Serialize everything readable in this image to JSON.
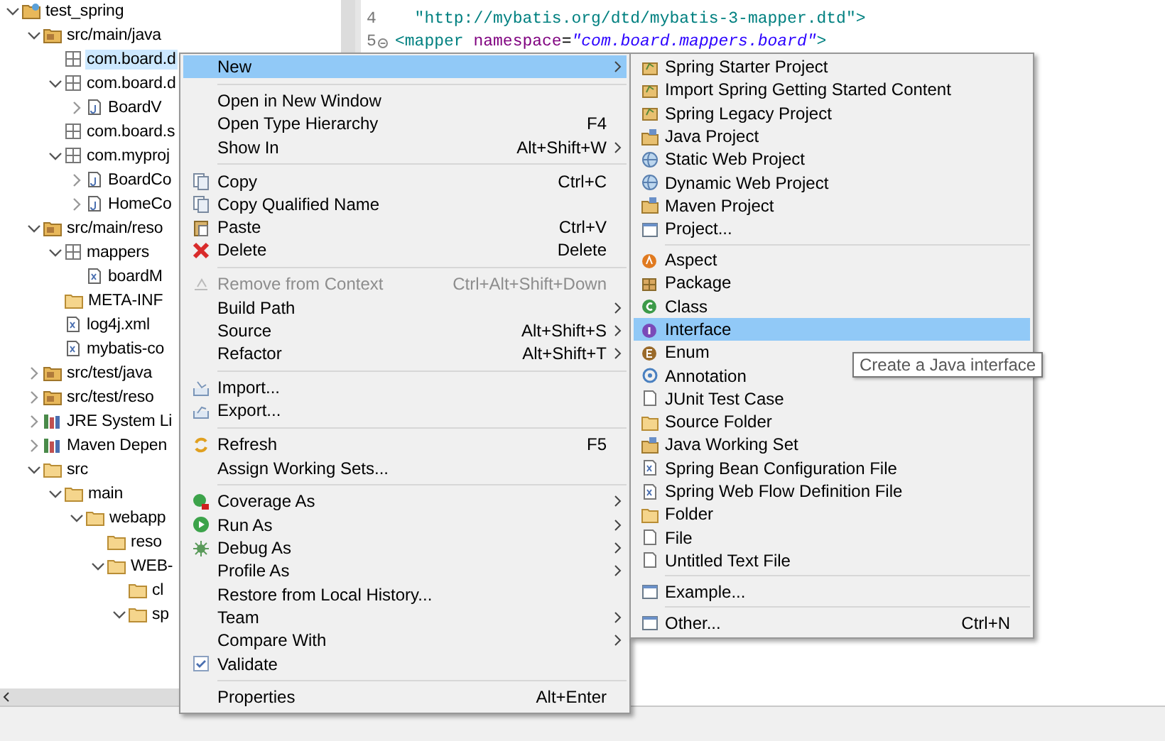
{
  "tree": [
    {
      "label": "test_spring",
      "kind": "project",
      "expanded": true,
      "selected": false,
      "children": [
        {
          "label": "src/main/java",
          "kind": "source-folder",
          "expanded": true,
          "selected": false,
          "children": [
            {
              "label": "com.board.d",
              "kind": "package",
              "selected": true
            },
            {
              "label": "com.board.d",
              "kind": "package",
              "expanded": true,
              "selected": false,
              "children": [
                {
                  "label": "BoardV",
                  "kind": "java-file",
                  "expanded": false,
                  "selected": false
                }
              ]
            },
            {
              "label": "com.board.s",
              "kind": "package",
              "selected": false
            },
            {
              "label": "com.myproj",
              "kind": "package",
              "expanded": true,
              "selected": false,
              "children": [
                {
                  "label": "BoardCo",
                  "kind": "java-file",
                  "expanded": false,
                  "selected": false
                },
                {
                  "label": "HomeCo",
                  "kind": "java-file",
                  "expanded": false,
                  "selected": false
                }
              ]
            }
          ]
        },
        {
          "label": "src/main/reso",
          "kind": "source-folder",
          "expanded": true,
          "selected": false,
          "children": [
            {
              "label": "mappers",
              "kind": "package",
              "expanded": true,
              "selected": false,
              "children": [
                {
                  "label": "boardM",
                  "kind": "xml-file",
                  "selected": false
                }
              ]
            },
            {
              "label": "META-INF",
              "kind": "folder",
              "selected": false
            },
            {
              "label": "log4j.xml",
              "kind": "xml-file",
              "selected": false
            },
            {
              "label": "mybatis-co",
              "kind": "xml-file",
              "selected": false
            }
          ]
        },
        {
          "label": "src/test/java",
          "kind": "source-folder",
          "expanded": false,
          "selected": false
        },
        {
          "label": "src/test/reso",
          "kind": "source-folder",
          "expanded": false,
          "selected": false
        },
        {
          "label": "JRE System Li",
          "kind": "library",
          "expanded": false,
          "selected": false
        },
        {
          "label": "Maven Depen",
          "kind": "library",
          "expanded": false,
          "selected": false
        },
        {
          "label": "src",
          "kind": "folder",
          "expanded": true,
          "selected": false,
          "children": [
            {
              "label": "main",
              "kind": "folder",
              "expanded": true,
              "selected": false,
              "children": [
                {
                  "label": "webapp",
                  "kind": "folder",
                  "expanded": true,
                  "selected": false,
                  "children": [
                    {
                      "label": "reso",
                      "kind": "folder",
                      "selected": false
                    },
                    {
                      "label": "WEB-",
                      "kind": "folder",
                      "expanded": true,
                      "selected": false,
                      "children": [
                        {
                          "label": "cl",
                          "kind": "folder",
                          "selected": false
                        },
                        {
                          "label": "sp",
                          "kind": "folder",
                          "expanded": true,
                          "selected": false
                        }
                      ]
                    }
                  ]
                }
              ]
            }
          ]
        }
      ]
    }
  ],
  "editor": {
    "lines": [
      {
        "number": "4",
        "tokens": [
          {
            "kind": "string",
            "text": "  \"http://mybatis.org/dtd/mybatis-3-mapper.dtd\">"
          }
        ]
      },
      {
        "number": "5",
        "fold": true,
        "tokens": [
          {
            "kind": "tag",
            "text": "<mapper"
          },
          {
            "kind": "attr",
            "text": " namespace"
          },
          {
            "kind": "plain",
            "text": "="
          },
          {
            "kind": "value",
            "text": "\"com.board.mappers.board\""
          },
          {
            "kind": "tag",
            "text": ">"
          }
        ]
      }
    ]
  },
  "context_menu": [
    {
      "kind": "item",
      "label": "New",
      "submenu": true,
      "selected": true,
      "disabled": false
    },
    {
      "kind": "separator"
    },
    {
      "kind": "item",
      "label": "Open in New Window",
      "selected": false,
      "disabled": false
    },
    {
      "kind": "item",
      "label": "Open Type Hierarchy",
      "shortcut": "F4",
      "selected": false,
      "disabled": false
    },
    {
      "kind": "item",
      "label": "Show In",
      "shortcut": "Alt+Shift+W",
      "submenu": true,
      "selected": false,
      "disabled": false
    },
    {
      "kind": "separator"
    },
    {
      "kind": "item",
      "label": "Copy",
      "shortcut": "Ctrl+C",
      "selected": false,
      "disabled": false
    },
    {
      "kind": "item",
      "label": "Copy Qualified Name",
      "selected": false,
      "disabled": false
    },
    {
      "kind": "item",
      "label": "Paste",
      "shortcut": "Ctrl+V",
      "selected": false,
      "disabled": false
    },
    {
      "kind": "item",
      "label": "Delete",
      "shortcut": "Delete",
      "selected": false,
      "disabled": false
    },
    {
      "kind": "separator"
    },
    {
      "kind": "item",
      "label": "Remove from Context",
      "shortcut": "Ctrl+Alt+Shift+Down",
      "selected": false,
      "disabled": true
    },
    {
      "kind": "item",
      "label": "Build Path",
      "submenu": true,
      "selected": false,
      "disabled": false
    },
    {
      "kind": "item",
      "label": "Source",
      "shortcut": "Alt+Shift+S",
      "submenu": true,
      "selected": false,
      "disabled": false
    },
    {
      "kind": "item",
      "label": "Refactor",
      "shortcut": "Alt+Shift+T",
      "submenu": true,
      "selected": false,
      "disabled": false
    },
    {
      "kind": "separator"
    },
    {
      "kind": "item",
      "label": "Import...",
      "selected": false,
      "disabled": false
    },
    {
      "kind": "item",
      "label": "Export...",
      "selected": false,
      "disabled": false
    },
    {
      "kind": "separator"
    },
    {
      "kind": "item",
      "label": "Refresh",
      "shortcut": "F5",
      "selected": false,
      "disabled": false
    },
    {
      "kind": "item",
      "label": "Assign Working Sets...",
      "selected": false,
      "disabled": false
    },
    {
      "kind": "separator"
    },
    {
      "kind": "item",
      "label": "Coverage As",
      "submenu": true,
      "selected": false,
      "disabled": false
    },
    {
      "kind": "item",
      "label": "Run As",
      "submenu": true,
      "selected": false,
      "disabled": false
    },
    {
      "kind": "item",
      "label": "Debug As",
      "submenu": true,
      "selected": false,
      "disabled": false
    },
    {
      "kind": "item",
      "label": "Profile As",
      "submenu": true,
      "selected": false,
      "disabled": false
    },
    {
      "kind": "item",
      "label": "Restore from Local History...",
      "selected": false,
      "disabled": false
    },
    {
      "kind": "item",
      "label": "Team",
      "submenu": true,
      "selected": false,
      "disabled": false
    },
    {
      "kind": "item",
      "label": "Compare With",
      "submenu": true,
      "selected": false,
      "disabled": false
    },
    {
      "kind": "item",
      "label": "Validate",
      "checked": true,
      "selected": false,
      "disabled": false
    },
    {
      "kind": "separator"
    },
    {
      "kind": "item",
      "label": "Properties",
      "shortcut": "Alt+Enter",
      "selected": false,
      "disabled": false
    }
  ],
  "new_submenu": [
    {
      "kind": "item",
      "label": "Spring Starter Project",
      "selected": false
    },
    {
      "kind": "item",
      "label": "Import Spring Getting Started Content",
      "selected": false
    },
    {
      "kind": "item",
      "label": "Spring Legacy Project",
      "selected": false
    },
    {
      "kind": "item",
      "label": "Java Project",
      "selected": false
    },
    {
      "kind": "item",
      "label": "Static Web Project",
      "selected": false
    },
    {
      "kind": "item",
      "label": "Dynamic Web Project",
      "selected": false
    },
    {
      "kind": "item",
      "label": "Maven Project",
      "selected": false
    },
    {
      "kind": "item",
      "label": "Project...",
      "selected": false
    },
    {
      "kind": "separator"
    },
    {
      "kind": "item",
      "label": "Aspect",
      "selected": false
    },
    {
      "kind": "item",
      "label": "Package",
      "selected": false
    },
    {
      "kind": "item",
      "label": "Class",
      "selected": false
    },
    {
      "kind": "item",
      "label": "Interface",
      "selected": true
    },
    {
      "kind": "item",
      "label": "Enum",
      "selected": false
    },
    {
      "kind": "item",
      "label": "Annotation",
      "selected": false
    },
    {
      "kind": "item",
      "label": "JUnit Test Case",
      "selected": false
    },
    {
      "kind": "item",
      "label": "Source Folder",
      "selected": false
    },
    {
      "kind": "item",
      "label": "Java Working Set",
      "selected": false
    },
    {
      "kind": "item",
      "label": "Spring Bean Configuration File",
      "selected": false
    },
    {
      "kind": "item",
      "label": "Spring Web Flow Definition File",
      "selected": false
    },
    {
      "kind": "item",
      "label": "Folder",
      "selected": false
    },
    {
      "kind": "item",
      "label": "File",
      "selected": false
    },
    {
      "kind": "item",
      "label": "Untitled Text File",
      "selected": false
    },
    {
      "kind": "separator"
    },
    {
      "kind": "item",
      "label": "Example...",
      "selected": false
    },
    {
      "kind": "separator"
    },
    {
      "kind": "item",
      "label": "Other...",
      "shortcut": "Ctrl+N",
      "selected": false
    }
  ],
  "tooltip": "Create a Java interface"
}
